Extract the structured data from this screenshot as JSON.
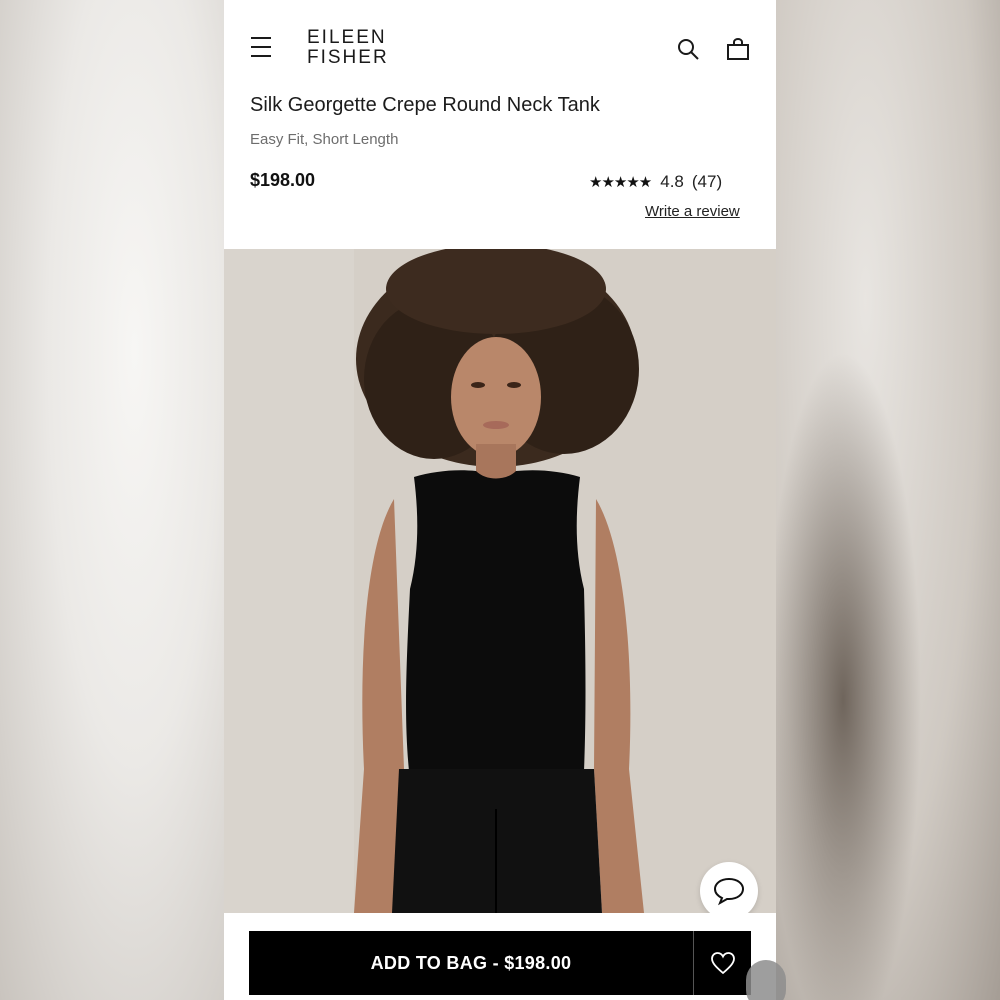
{
  "header": {
    "brand_line1": "EILEEN",
    "brand_line2": "FISHER",
    "icons": [
      "menu-icon",
      "search-icon",
      "shopping-bag-icon"
    ]
  },
  "product": {
    "title": "Silk Georgette Crepe Round Neck Tank",
    "fit": "Easy Fit, Short Length",
    "price": "$198.00",
    "stars": "★★★★★",
    "rating": "4.8",
    "review_count": "(47)",
    "write_review": "Write a review"
  },
  "actions": {
    "add_to_bag": "ADD TO BAG - $198.00",
    "icons": [
      "heart-icon",
      "chat-icon"
    ]
  },
  "colors": {
    "button": "#000000",
    "text": "#1c1c1c"
  }
}
